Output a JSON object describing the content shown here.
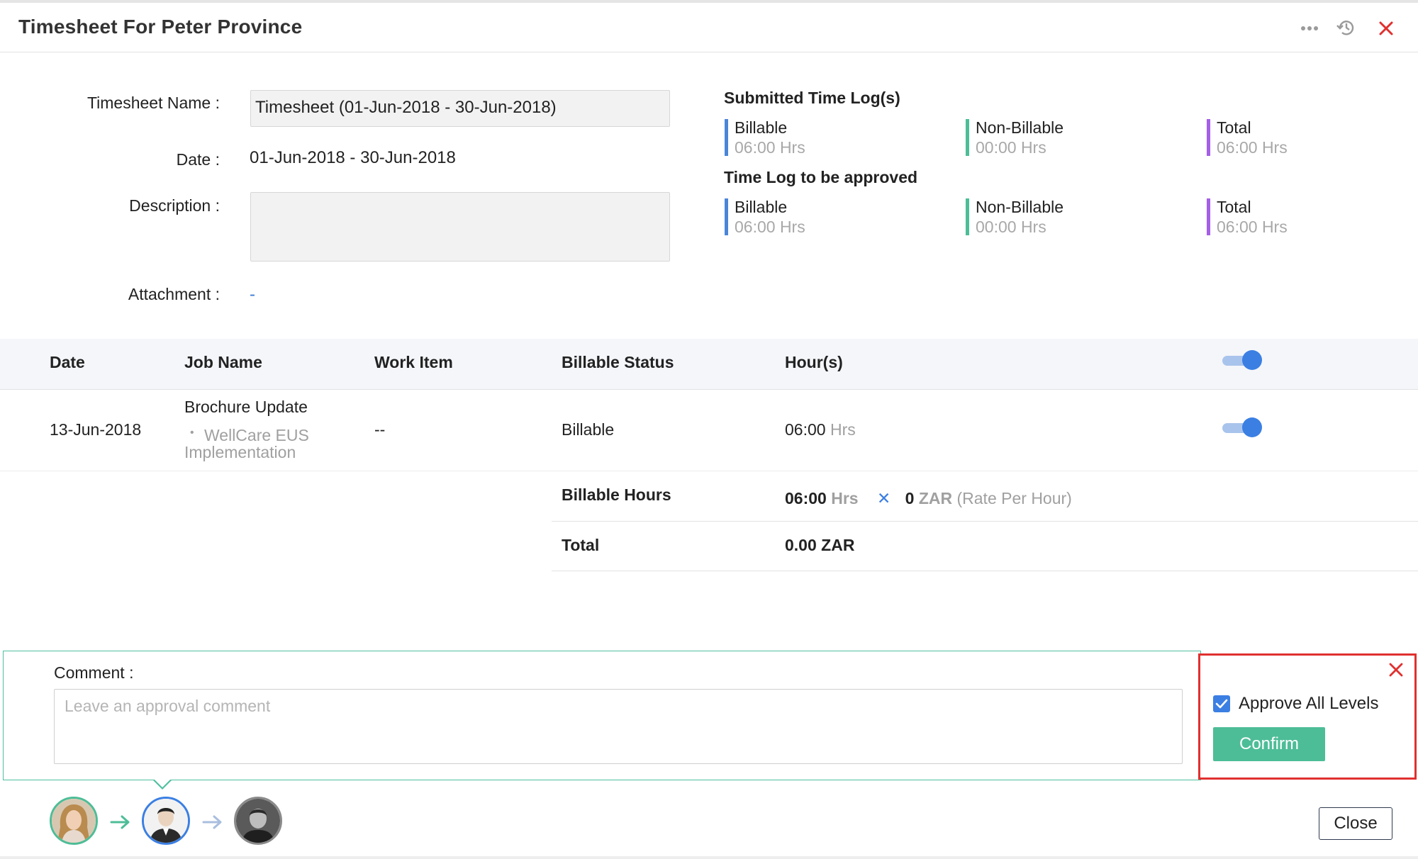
{
  "header": {
    "title": "Timesheet For Peter Province",
    "icons": [
      "more-options-icon",
      "history-icon",
      "close-icon"
    ]
  },
  "form": {
    "name_label": "Timesheet Name :",
    "name_value": "Timesheet (01-Jun-2018 - 30-Jun-2018)",
    "date_label": "Date :",
    "date_value": "01-Jun-2018 - 30-Jun-2018",
    "description_label": "Description :",
    "description_value": "",
    "attachment_label": "Attachment :",
    "attachment_value": "-"
  },
  "summary": {
    "submitted_heading": "Submitted Time Log(s)",
    "submitted": [
      {
        "label": "Billable",
        "value": "06:00 Hrs",
        "color": "#4a86d8"
      },
      {
        "label": "Non-Billable",
        "value": "00:00 Hrs",
        "color": "#4dbd97"
      },
      {
        "label": "Total",
        "value": "06:00 Hrs",
        "color": "#a55ee8"
      }
    ],
    "approve_heading": "Time Log to be approved",
    "approve": [
      {
        "label": "Billable",
        "value": "06:00 Hrs",
        "color": "#4a86d8"
      },
      {
        "label": "Non-Billable",
        "value": "00:00 Hrs",
        "color": "#4dbd97"
      },
      {
        "label": "Total",
        "value": "06:00 Hrs",
        "color": "#a55ee8"
      }
    ]
  },
  "table": {
    "columns": [
      "Date",
      "Job Name",
      "Work Item",
      "Billable Status",
      "Hour(s)"
    ],
    "header_toggle_on": true,
    "rows": [
      {
        "date": "13-Jun-2018",
        "job_name": "Brochure Update",
        "project_bullet": "•",
        "project": "WellCare EUS",
        "project_line2": "Implementation",
        "work_item": "--",
        "billable_status": "Billable",
        "hours": "06:00",
        "hours_unit": "Hrs",
        "toggle_on": true
      }
    ]
  },
  "totals": {
    "billable_hours_label": "Billable Hours",
    "billable_hours_value": "06:00",
    "billable_hours_unit": "Hrs",
    "multiply_symbol": "✕",
    "rate_value": "0",
    "rate_currency": "ZAR",
    "rate_note": "(Rate Per Hour)",
    "total_label": "Total",
    "total_value": "0.00",
    "total_currency": "ZAR"
  },
  "comment": {
    "label": "Comment :",
    "placeholder": "Leave an approval comment"
  },
  "approval": {
    "approve_all_label": "Approve All Levels",
    "approve_all_checked": true,
    "confirm_label": "Confirm"
  },
  "workflow": {
    "approvers": [
      "approver-1-avatar",
      "approver-2-avatar",
      "approver-3-avatar"
    ]
  },
  "footer": {
    "close_label": "Close"
  },
  "colors": {
    "accent_blue": "#3b7fe3",
    "accent_green": "#4dbd97",
    "highlight_red": "#e0302f",
    "close_red": "#e0302f"
  }
}
